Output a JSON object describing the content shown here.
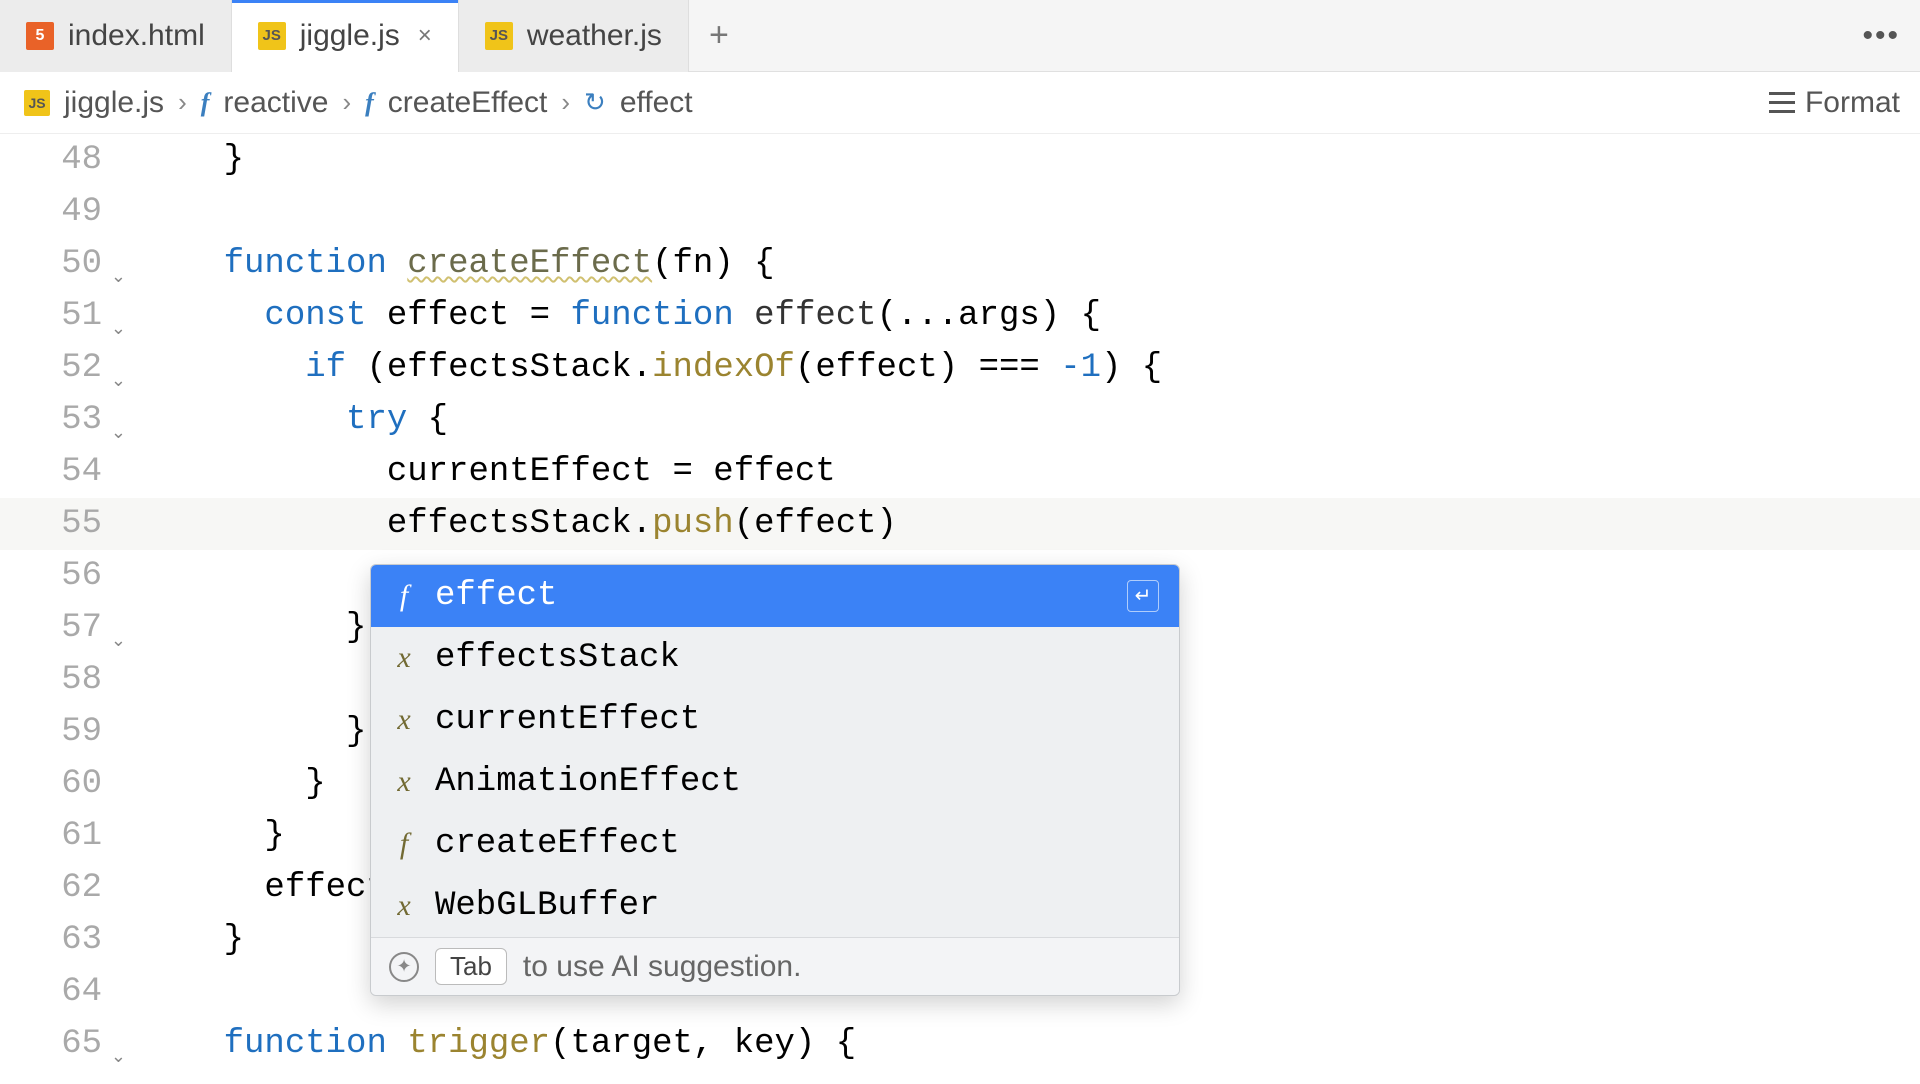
{
  "tabs": [
    {
      "icon": "html",
      "iconText": "5",
      "label": "index.html",
      "active": false,
      "close": false
    },
    {
      "icon": "js",
      "iconText": "JS",
      "label": "jiggle.js",
      "active": true,
      "close": true
    },
    {
      "icon": "js",
      "iconText": "JS",
      "label": "weather.js",
      "active": false,
      "close": false
    }
  ],
  "newTabGlyph": "+",
  "overflowGlyph": "•••",
  "breadcrumb": {
    "fileIconText": "JS",
    "file": "jiggle.js",
    "items": [
      {
        "kind": "f",
        "label": "reactive"
      },
      {
        "kind": "f",
        "label": "createEffect"
      },
      {
        "kind": "refresh",
        "label": "effect"
      }
    ],
    "sep": "›",
    "formatLabel": "Format"
  },
  "code": {
    "startLine": 48,
    "lines": [
      {
        "n": 48,
        "fold": false,
        "html": "    }"
      },
      {
        "n": 49,
        "fold": false,
        "html": ""
      },
      {
        "n": 50,
        "fold": true,
        "html": "    <span class='kw'>function</span> <span class='fn-name'>createEffect</span>(fn) {"
      },
      {
        "n": 51,
        "fold": true,
        "html": "      <span class='kw'>const</span> effect = <span class='kw'>function</span> <span class='ident'>effect</span>(...args) {"
      },
      {
        "n": 52,
        "fold": true,
        "html": "        <span class='kw'>if</span> (effectsStack.<span class='fn-call'>indexOf</span>(effect) === <span class='num'>-1</span>) {"
      },
      {
        "n": 53,
        "fold": true,
        "html": "          <span class='kw'>try</span> {"
      },
      {
        "n": 54,
        "fold": false,
        "html": "            currentEffect = effect"
      },
      {
        "n": 55,
        "fold": false,
        "html": "            effectsStack.<span class='fn-call'>push</span>(effect)",
        "hl": true
      },
      {
        "n": 56,
        "fold": false,
        "html": ""
      },
      {
        "n": 57,
        "fold": true,
        "html": "          }"
      },
      {
        "n": 58,
        "fold": false,
        "html": ""
      },
      {
        "n": 59,
        "fold": false,
        "html": "          }"
      },
      {
        "n": 60,
        "fold": false,
        "html": "        }"
      },
      {
        "n": 61,
        "fold": false,
        "html": "      }"
      },
      {
        "n": 62,
        "fold": false,
        "html": "      effect"
      },
      {
        "n": 63,
        "fold": false,
        "html": "    }"
      },
      {
        "n": 64,
        "fold": false,
        "html": ""
      },
      {
        "n": 65,
        "fold": true,
        "html": "    <span class='kw'>function</span> <span class='fn-call'>trigger</span>(target, key) {"
      }
    ]
  },
  "autocomplete": {
    "items": [
      {
        "kind": "f",
        "label": "effect",
        "match": "ct",
        "selected": true
      },
      {
        "kind": "x",
        "label": "effectsStack",
        "match": "cts",
        "selected": false
      },
      {
        "kind": "x",
        "label": "currentEffect",
        "match": "ct",
        "selected": false
      },
      {
        "kind": "x",
        "label": "AnimationEffect",
        "match": "ct",
        "selected": false
      },
      {
        "kind": "f",
        "label": "createEffect",
        "match": "ct",
        "selected": false
      },
      {
        "kind": "x",
        "label": "WebGLBuffer",
        "match": "",
        "selected": false
      }
    ],
    "enterGlyph": "↵",
    "footer": {
      "sparkleGlyph": "✦",
      "tabLabel": "Tab",
      "hint": "to use AI suggestion."
    }
  }
}
